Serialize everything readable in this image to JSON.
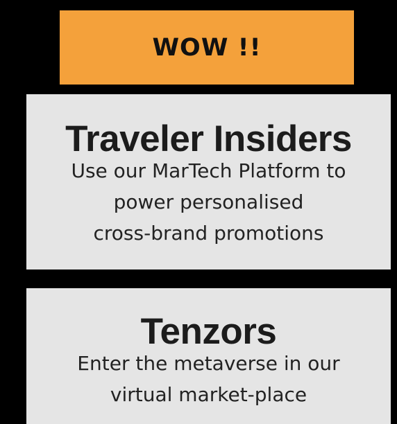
{
  "banner": {
    "label": "WOW !!",
    "color": "#f4a13b"
  },
  "cards": [
    {
      "title": "Traveler Insiders",
      "description_lines": [
        "Use our MarTech Platform to",
        "power personalised",
        "cross-brand promotions"
      ]
    },
    {
      "title": "Tenzors",
      "description_lines": [
        "Enter the metaverse in our",
        "virtual market-place"
      ]
    }
  ],
  "colors": {
    "background": "#000000",
    "card": "#e5e5e5",
    "accent": "#f4a13b"
  }
}
